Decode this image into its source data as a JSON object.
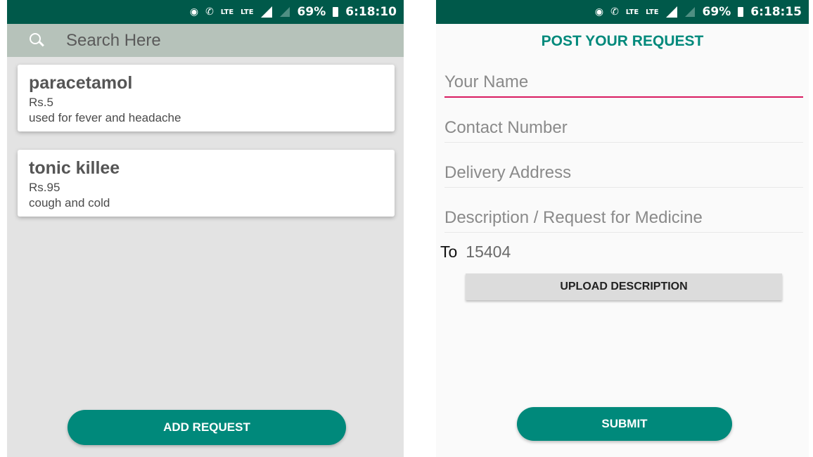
{
  "screens": {
    "left": {
      "status_bar": {
        "battery": "69%",
        "time": "6:18:10",
        "lte1": "LTE",
        "lte2": "LTE"
      },
      "search": {
        "placeholder": "Search Here"
      },
      "medicines": [
        {
          "name": "paracetamol",
          "price": "Rs.5",
          "description": "used for fever and headache"
        },
        {
          "name": "tonic killee",
          "price": "Rs.95",
          "description": "cough and cold"
        }
      ],
      "add_request_label": "ADD REQUEST"
    },
    "right": {
      "status_bar": {
        "battery": "69%",
        "time": "6:18:15",
        "lte1": "LTE",
        "lte2": "LTE"
      },
      "title": "POST YOUR REQUEST",
      "fields": {
        "name_placeholder": "Your Name",
        "contact_placeholder": "Contact Number",
        "address_placeholder": "Delivery Address",
        "description_placeholder": "Description / Request for Medicine"
      },
      "to_label": "To",
      "to_value": "15404",
      "upload_label": "UPLOAD DESCRIPTION",
      "submit_label": "SUBMIT"
    }
  },
  "colors": {
    "status_bar": "#00594a",
    "accent": "#00897b",
    "search_bar": "#b6c2ba",
    "field_focus": "#d81b60"
  }
}
